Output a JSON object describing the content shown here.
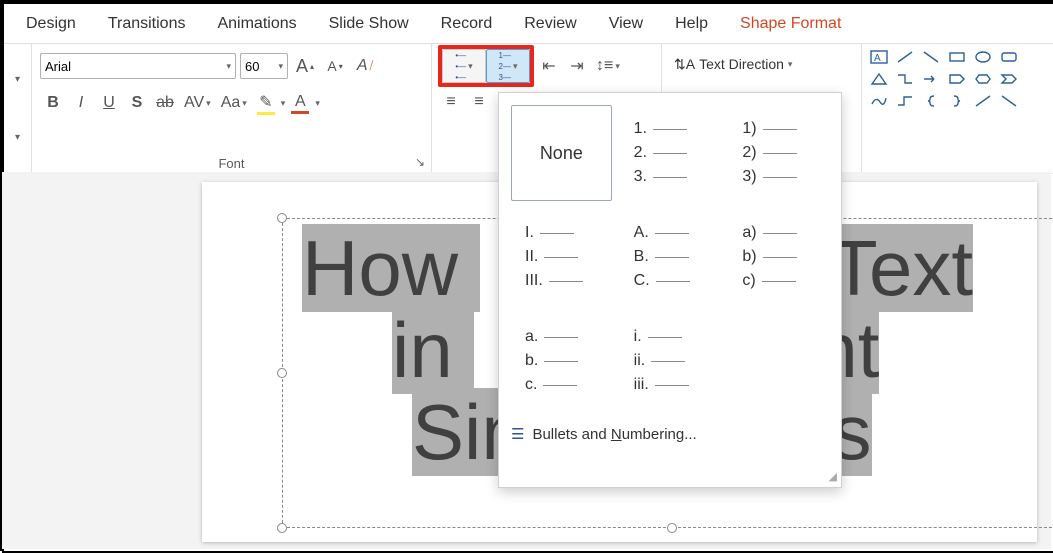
{
  "tabs": [
    "Design",
    "Transitions",
    "Animations",
    "Slide Show",
    "Record",
    "Review",
    "View",
    "Help",
    "Shape Format"
  ],
  "accentTabIndex": 8,
  "font": {
    "name": "Arial",
    "size": "60",
    "groupLabel": "Font",
    "bold": "B",
    "italic": "I",
    "underline": "U",
    "shadow": "S",
    "strike": "ab",
    "charSpace": "AV",
    "changeCase": "Aa",
    "growFont": "A",
    "shrinkFont": "A",
    "clear": "A",
    "highlightColor": "#FFEB3B",
    "fontColorSwatch": "#D24726",
    "fontColorGlyph": "A"
  },
  "paragraph": {
    "textDirection": "Text Direction"
  },
  "numbering": {
    "none": "None",
    "options": [
      [
        "1.",
        "2.",
        "3."
      ],
      [
        "1)",
        "2)",
        "3)"
      ],
      [
        "I.",
        "II.",
        "III."
      ],
      [
        "A.",
        "B.",
        "C."
      ],
      [
        "a)",
        "b)",
        "c)"
      ],
      [
        "a.",
        "b.",
        "c."
      ],
      [
        "i.",
        "ii.",
        "iii."
      ]
    ],
    "footer_pre": "Bullets and ",
    "footer_ul": "N",
    "footer_post": "umbering..."
  },
  "slide": {
    "lines": [
      {
        "pre": "How ",
        "mid": "",
        "post": " Text"
      },
      {
        "pre": "in ",
        "mid": "",
        "post": "t"
      },
      {
        "pre": "",
        "mid": "Simple Steps",
        "post": ""
      }
    ]
  }
}
